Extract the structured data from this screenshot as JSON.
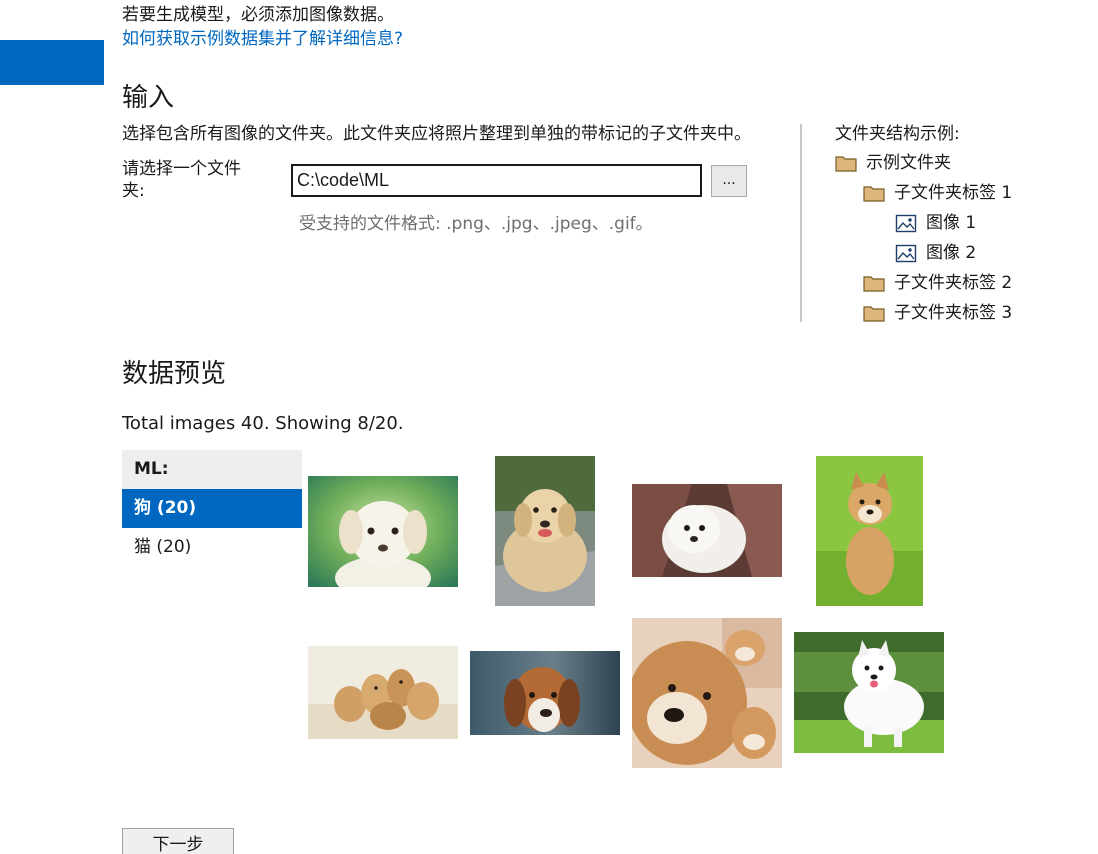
{
  "intro": {
    "note": "若要生成模型，必须添加图像数据。",
    "link": "如何获取示例数据集并了解详细信息?"
  },
  "input_section": {
    "title": "输入",
    "description": "选择包含所有图像的文件夹。此文件夹应将照片整理到单独的带标记的子文件夹中。",
    "folder_label": "请选择一个文件夹:",
    "folder_value": "C:\\code\\ML",
    "browse_label": "...",
    "formats_hint": "受支持的文件格式: .png、.jpg、.jpeg、.gif。"
  },
  "folder_tree": {
    "title": "文件夹结构示例:",
    "items": [
      {
        "label": "示例文件夹",
        "icon": "folder-icon"
      },
      {
        "label": "子文件夹标签 1",
        "icon": "folder-icon"
      },
      {
        "label": "图像 1",
        "icon": "image-icon"
      },
      {
        "label": "图像 2",
        "icon": "image-icon"
      },
      {
        "label": "子文件夹标签 2",
        "icon": "folder-icon"
      },
      {
        "label": "子文件夹标签 3",
        "icon": "folder-icon"
      }
    ]
  },
  "preview": {
    "title": "数据预览",
    "summary": "Total images 40. Showing 8/20.",
    "labels_header": "ML:",
    "labels": [
      {
        "label": "狗 (20)",
        "selected": true
      },
      {
        "label": "猫 (20)",
        "selected": false
      }
    ],
    "images": [
      {
        "name": "dog-image-1",
        "subject": "white puppy on green background"
      },
      {
        "name": "dog-image-2",
        "subject": "golden retriever lying on path"
      },
      {
        "name": "dog-image-3",
        "subject": "white fluffy puppy"
      },
      {
        "name": "dog-image-4",
        "subject": "shiba inu puppy on grass"
      },
      {
        "name": "dog-image-5",
        "subject": "litter of puppies on sofa"
      },
      {
        "name": "dog-image-6",
        "subject": "beagle portrait"
      },
      {
        "name": "dog-image-7",
        "subject": "shiba inu with puppies close-up"
      },
      {
        "name": "dog-image-8",
        "subject": "white samoyed on grass"
      }
    ]
  },
  "footer": {
    "next_label": "下一步"
  },
  "colors": {
    "accent": "#0067c0",
    "folder": "#dcb67a",
    "hint": "#6e6e6e"
  }
}
